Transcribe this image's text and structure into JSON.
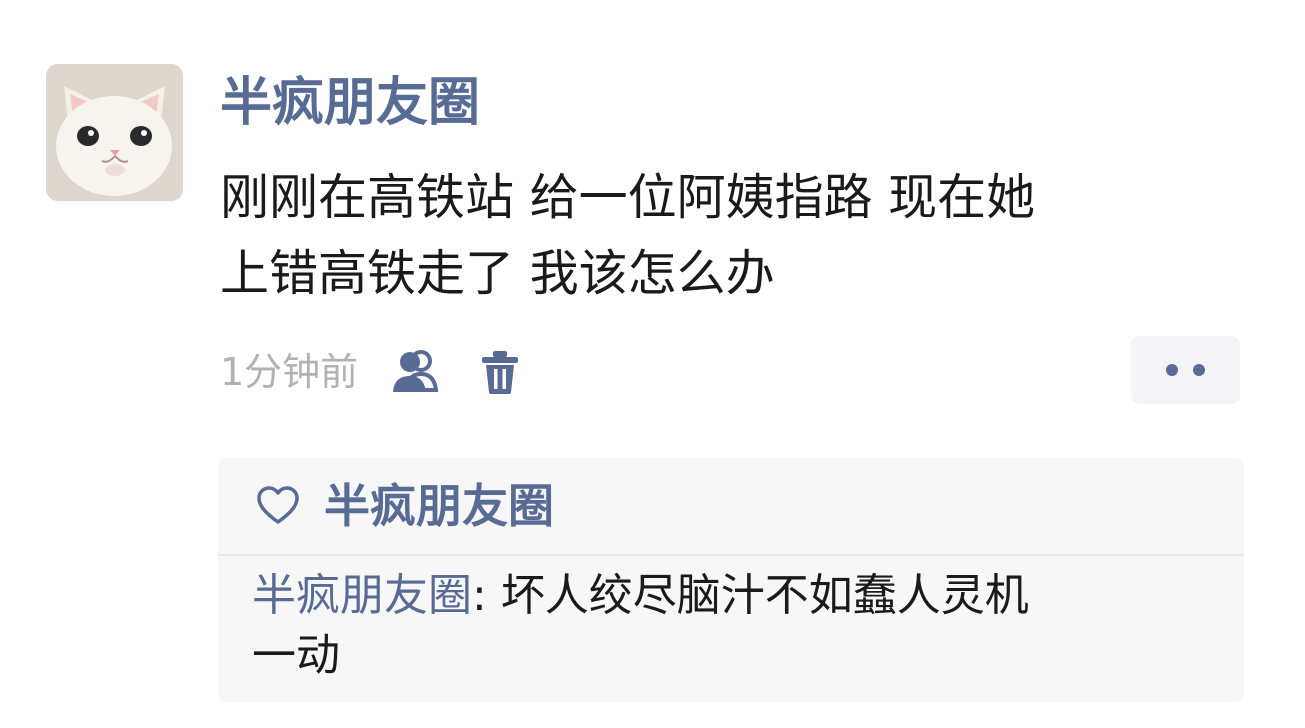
{
  "post": {
    "author": "半疯朋友圈",
    "text_lines": [
      "刚刚在高铁站 给一位阿姨指路 现在她",
      "上错高铁走了 我该怎么办"
    ],
    "time": "1分钟前"
  },
  "likes": {
    "names": "半疯朋友圈"
  },
  "comment": {
    "author": "半疯朋友圈",
    "separator": ": ",
    "text_line1": "坏人绞尽脑汁不如蠢人灵机",
    "text_line2": "一动"
  },
  "icons": {
    "avatar": "cat-avatar",
    "visibility": "friends-icon",
    "delete": "trash-icon",
    "more": "more-dots-icon",
    "like": "heart-outline-icon"
  },
  "colors": {
    "link_blue": "#576b95",
    "time_gray": "#b2b2b2",
    "panel_bg": "#f7f7f7",
    "text": "#1a1a1a"
  }
}
